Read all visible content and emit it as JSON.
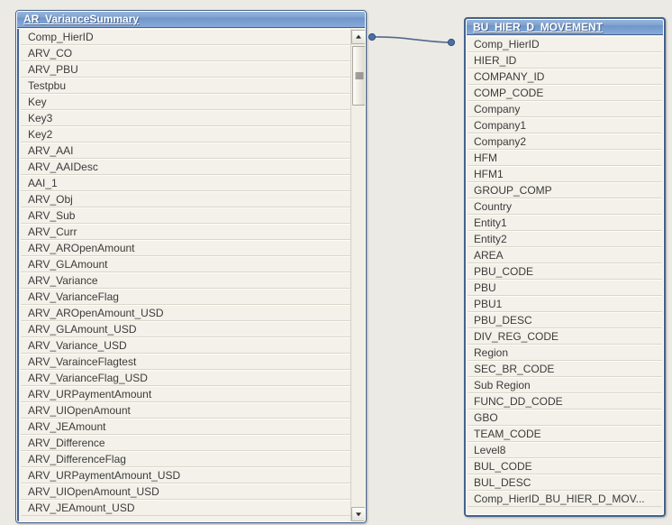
{
  "canvas": {
    "background_color": "#eceae4",
    "accent_color": "#44628c",
    "row_background_color": "#f3f1e9"
  },
  "left_table": {
    "title": "AR_VarianceSummary",
    "fields": [
      "Comp_HierID",
      "ARV_CO",
      "ARV_PBU",
      "Testpbu",
      "Key",
      "Key3",
      "Key2",
      "ARV_AAI",
      "ARV_AAIDesc",
      "AAI_1",
      "ARV_Obj",
      "ARV_Sub",
      "ARV_Curr",
      "ARV_AROpenAmount",
      "ARV_GLAmount",
      "ARV_Variance",
      "ARV_VarianceFlag",
      "ARV_AROpenAmount_USD",
      "ARV_GLAmount_USD",
      "ARV_Variance_USD",
      "ARV_VarainceFlagtest",
      "ARV_VarianceFlag_USD",
      "ARV_URPaymentAmount",
      "ARV_UIOpenAmount",
      "ARV_JEAmount",
      "ARV_Difference",
      "ARV_DifferenceFlag",
      "ARV_URPaymentAmount_USD",
      "ARV_UIOpenAmount_USD",
      "ARV_JEAmount_USD"
    ],
    "scrollbar": {
      "up_arrow_icon": "scroll-up-arrow-icon",
      "down_arrow_icon": "scroll-down-arrow-icon",
      "thumb_grip_icon": "scrollbar-grip-icon"
    }
  },
  "right_table": {
    "title": "BU_HIER_D_MOVEMENT",
    "fields": [
      "Comp_HierID",
      "HIER_ID",
      "COMPANY_ID",
      "COMP_CODE",
      "Company",
      "Company1",
      "Company2",
      "HFM",
      "HFM1",
      "GROUP_COMP",
      "Country",
      "Entity1",
      "Entity2",
      "AREA",
      "PBU_CODE",
      "PBU",
      "PBU1",
      "PBU_DESC",
      "DIV_REG_CODE",
      "Region",
      "SEC_BR_CODE",
      "Sub Region",
      "FUNC_DD_CODE",
      "GBO",
      "TEAM_CODE",
      "Level8",
      "BUL_CODE",
      "BUL_DESC",
      "Comp_HierID_BU_HIER_D_MOV..."
    ]
  },
  "relationship": {
    "name": "join-line",
    "from_field": "Comp_HierID",
    "to_field": "Comp_HierID",
    "line_color": "#53698f",
    "endpoint_color": "#4a6fa8"
  }
}
